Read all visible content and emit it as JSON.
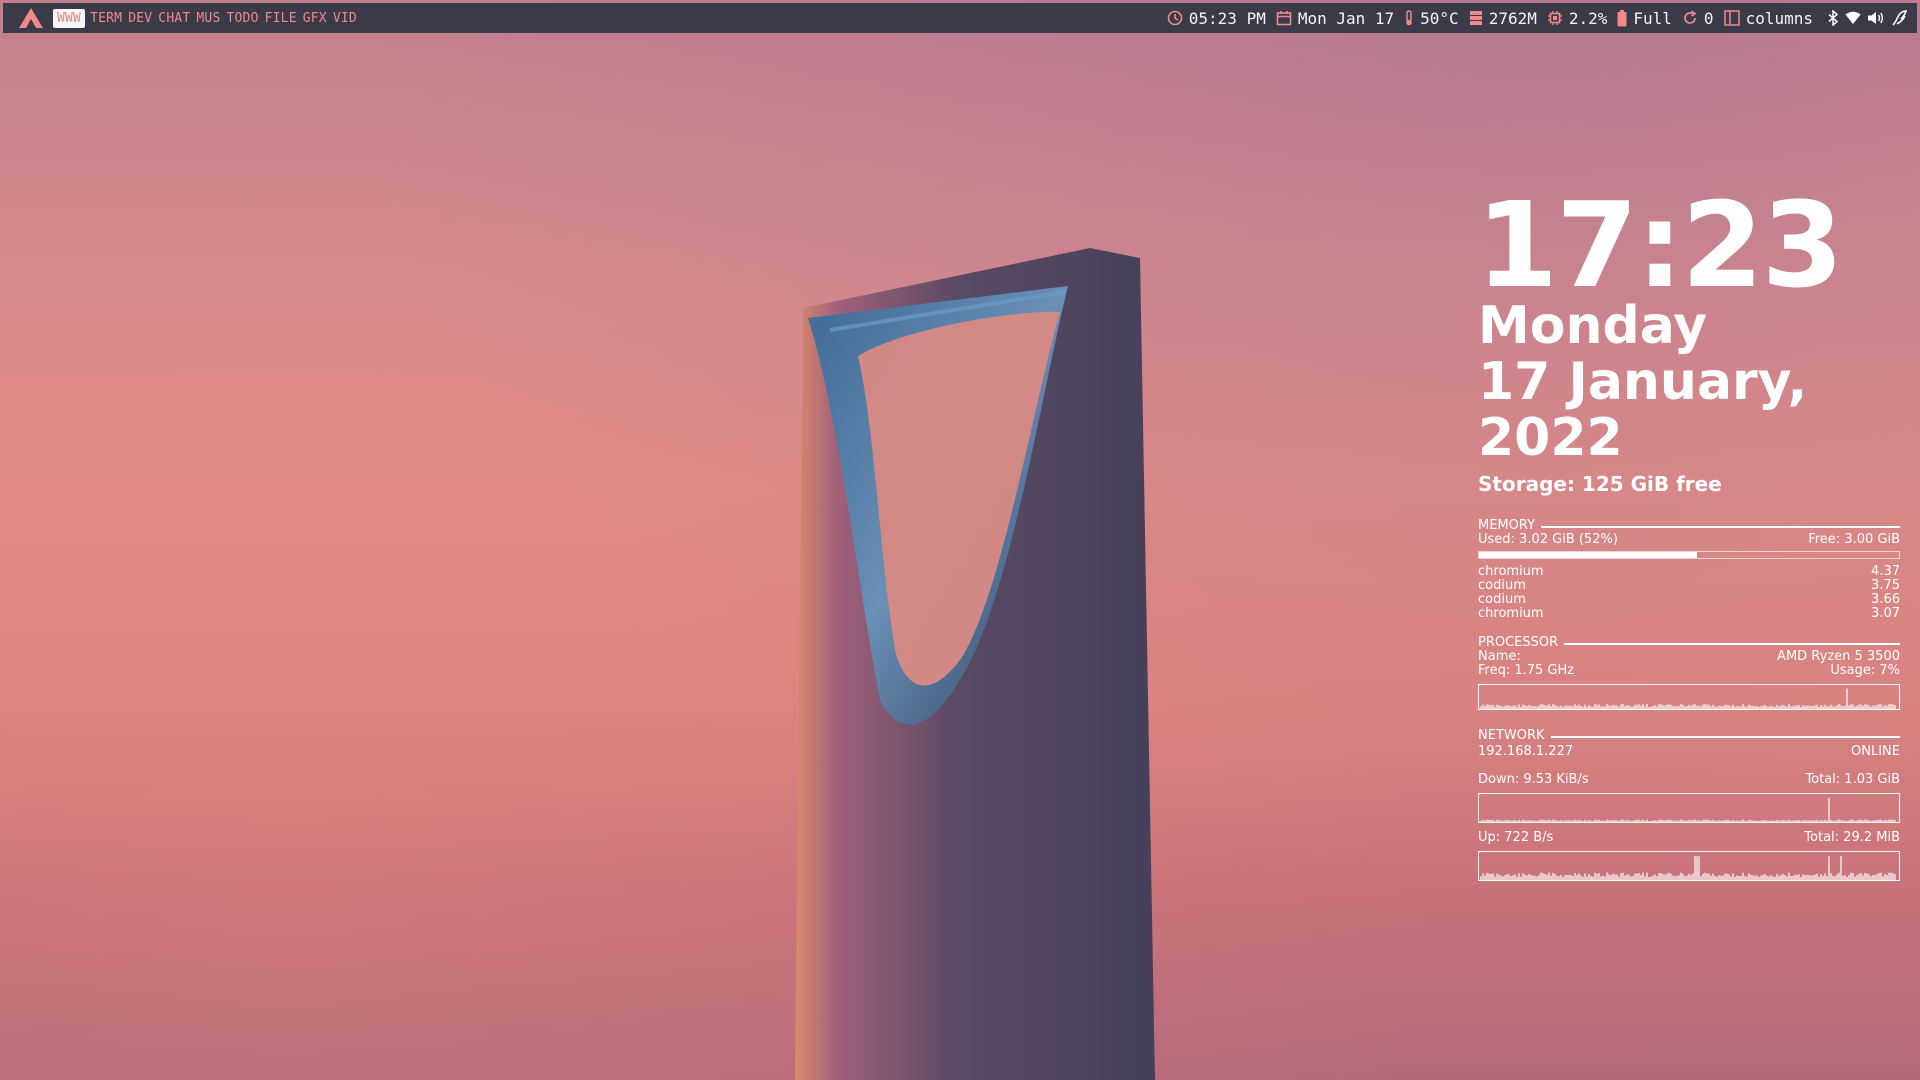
{
  "topbar": {
    "workspaces": [
      "WWW",
      "TERM",
      "DEV",
      "CHAT",
      "MUS",
      "TODO",
      "FILE",
      "GFX",
      "VID"
    ],
    "active_workspace": "WWW",
    "time": "05:23 PM",
    "date": "Mon Jan 17",
    "temperature": "50°C",
    "memory": "2762M",
    "cpu": "2.2%",
    "battery": "Full",
    "updates": "0",
    "layout": "columns",
    "icon_color": "#f08a8a",
    "bar_color": "#3b3a48"
  },
  "conky": {
    "clock": "17:23",
    "day": "Monday",
    "date": "17 January, 2022",
    "storage": "Storage: 125 GiB free",
    "memory": {
      "title": "MEMORY",
      "used": "Used: 3.02 GiB (52%)",
      "free": "Free: 3.00 GiB",
      "used_fraction": 0.52,
      "processes": [
        {
          "name": "chromium",
          "value": "4.37"
        },
        {
          "name": "codium",
          "value": "3.75"
        },
        {
          "name": "codium",
          "value": "3.66"
        },
        {
          "name": "chromium",
          "value": "3.07"
        }
      ]
    },
    "processor": {
      "title": "PROCESSOR",
      "name_label": "Name:",
      "name_value": "AMD Ryzen 5 3500",
      "freq": "Freq: 1.75 GHz",
      "usage": "Usage: 7%"
    },
    "network": {
      "title": "NETWORK",
      "ip": "192.168.1.227",
      "state": "ONLINE",
      "down": "Down: 9.53 KiB/s",
      "down_total": "Total: 1.03 GiB",
      "up": "Up: 722 B/s",
      "up_total": "Total: 29.2 MiB"
    }
  }
}
